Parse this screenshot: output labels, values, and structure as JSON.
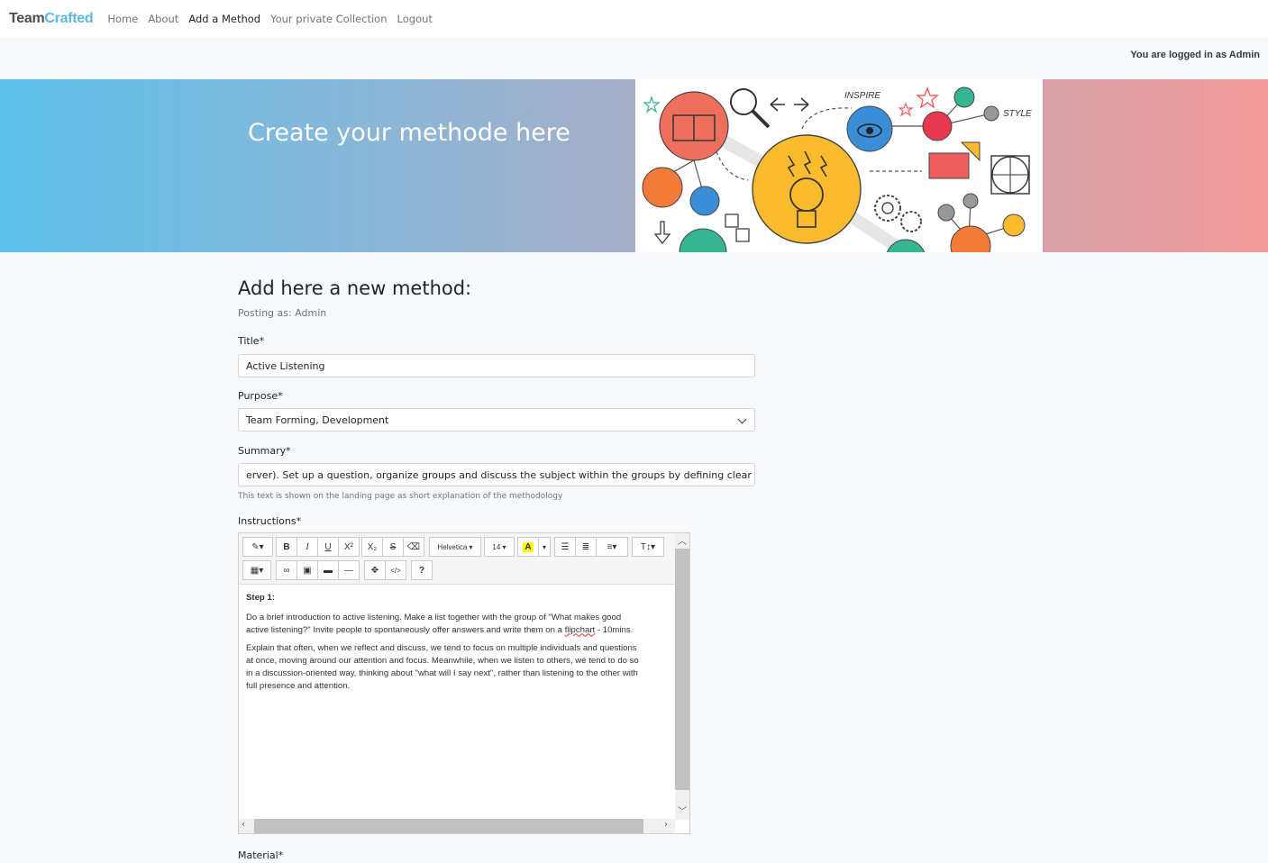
{
  "nav": {
    "brand_part1": "Team",
    "brand_part2": "Crafted",
    "links": [
      "Home",
      "About",
      "Add a Method",
      "Your private Collection",
      "Logout"
    ],
    "active": "Add a Method"
  },
  "login_status": "You are logged in as Admin",
  "hero": {
    "title": "Create your methode here",
    "illustration_labels": [
      "INSPIRE",
      "STYLE"
    ]
  },
  "form": {
    "heading": "Add here a new method:",
    "posting_as": "Posting as: Admin",
    "title_label": "Title*",
    "title_value": "Active Listening",
    "purpose_label": "Purpose*",
    "purpose_value": "Team Forming, Development",
    "summary_label": "Summary*",
    "summary_value": "erver). Set up a question, organize groups and discuss the subject within the groups by defining clear roles.",
    "summary_help": "This text is shown on the landing page as short explanation of the methodology",
    "instructions_label": "Instructions*",
    "material_label": "Material*"
  },
  "editor": {
    "font_name": "Helvetica",
    "font_size": "14",
    "step_heading": "Step 1:",
    "p1_line1": "Do a brief introduction to active listening. Make a list together with the group of \"What makes good",
    "p1_line2_a": "active listening?\" Invite people to spontaneously offer answers and write them on a ",
    "p1_line2_flag": "flipchart",
    "p1_line2_b": " - 10mins.",
    "p2_line1": "Explain that often, when we reflect and discuss, we tend to focus on multiple individuals and questions",
    "p2_line2": "at once, moving around our attention and focus. Meanwhile, when we listen to others, we tend to do so",
    "p2_line3": "in a discussion-oriented way, thinking about \"what will I say next\", rather than listening to the other with",
    "p2_line4": "full presence and attention."
  },
  "colors": {
    "brand_accent": "#5bb8df",
    "hero_left": "#5ec2ec",
    "hero_right": "#f29a98"
  }
}
